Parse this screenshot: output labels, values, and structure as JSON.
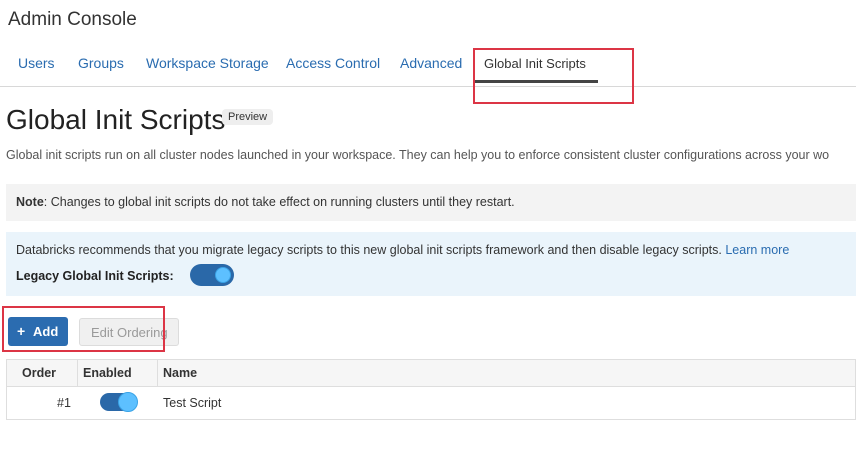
{
  "app": {
    "title": "Admin Console"
  },
  "tabs": [
    {
      "label": "Users"
    },
    {
      "label": "Groups"
    },
    {
      "label": "Workspace Storage"
    },
    {
      "label": "Access Control"
    },
    {
      "label": "Advanced"
    },
    {
      "label": "Global Init Scripts",
      "active": true
    }
  ],
  "page": {
    "title": "Global Init Scripts",
    "badge": "Preview",
    "description": "Global init scripts run on all cluster nodes launched in your workspace. They can help you to enforce consistent cluster configurations across your wo"
  },
  "note": {
    "label": "Note",
    "text": ": Changes to global init scripts do not take effect on running clusters until they restart."
  },
  "info": {
    "text": "Databricks recommends that you migrate legacy scripts to this new global init scripts framework and then disable legacy scripts.",
    "link": "Learn more",
    "legacy_label": "Legacy Global Init Scripts:",
    "legacy_enabled": true
  },
  "toolbar": {
    "add_icon": "+",
    "add_label": "Add",
    "edit_ordering_label": "Edit Ordering"
  },
  "table": {
    "headers": [
      "Order",
      "Enabled",
      "Name"
    ],
    "rows": [
      {
        "order": "#1",
        "enabled": true,
        "name": "Test Script"
      }
    ]
  },
  "colors": {
    "accent": "#2b6cb0",
    "highlight": "#dc3545",
    "toggle_on": "#2a68a8",
    "info_bg": "#eaf4fb",
    "note_bg": "#f3f3f3"
  }
}
